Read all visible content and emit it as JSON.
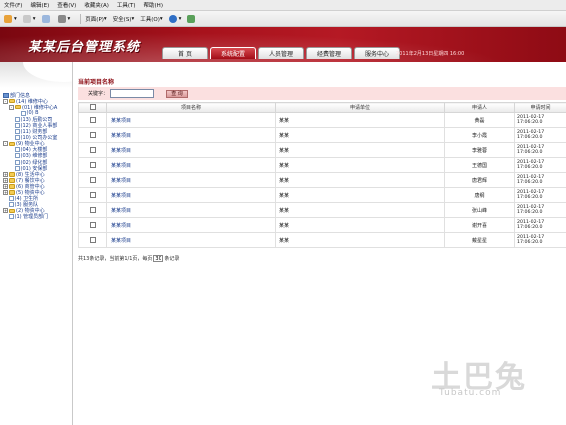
{
  "browser": {
    "menus": [
      "文件(F)",
      "编辑(E)",
      "查看(V)",
      "收藏夹(A)",
      "工具(T)",
      "帮助(H)"
    ],
    "toolbar": {
      "page": "页面(P)",
      "safety": "安全(S)",
      "tools": "工具(O)"
    }
  },
  "header": {
    "app_title": "某某后台管理系统",
    "tabs": [
      "首 页",
      "系统配置",
      "人员管理",
      "经费管理",
      "服务中心"
    ],
    "active_tab": 1,
    "date_text": "2011年2月13日星期四 16:00"
  },
  "tree": {
    "root": "部门信息",
    "nodes": [
      {
        "label": "(14) 维修中心",
        "level": 0,
        "expander": "-",
        "icon": "folder-icon"
      },
      {
        "label": "(01) 维修中心A",
        "level": 1,
        "expander": "-",
        "icon": "folder-icon"
      },
      {
        "label": "(0) B",
        "level": 2,
        "expander": "",
        "icon": "doc-icon"
      },
      {
        "label": "(13) 后勤公司",
        "level": 1,
        "expander": "",
        "icon": "doc-icon"
      },
      {
        "label": "(12) 商业人事部",
        "level": 1,
        "expander": "",
        "icon": "doc-icon"
      },
      {
        "label": "(11) 财务部",
        "level": 1,
        "expander": "",
        "icon": "doc-icon"
      },
      {
        "label": "(10) 公司办公室",
        "level": 1,
        "expander": "",
        "icon": "doc-icon"
      },
      {
        "label": "(9) 物业中心",
        "level": 0,
        "expander": "-",
        "icon": "folder-icon"
      },
      {
        "label": "(04) 大楼部",
        "level": 1,
        "expander": "",
        "icon": "doc-icon"
      },
      {
        "label": "(03) 维修部",
        "level": 1,
        "expander": "",
        "icon": "doc-icon"
      },
      {
        "label": "(02) 绿化部",
        "level": 1,
        "expander": "",
        "icon": "doc-icon"
      },
      {
        "label": "(01) 安保部",
        "level": 1,
        "expander": "",
        "icon": "doc-icon"
      },
      {
        "label": "(8) 生活中心",
        "level": 0,
        "expander": "+",
        "icon": "folder-icon"
      },
      {
        "label": "(7) 餐饮中心",
        "level": 0,
        "expander": "+",
        "icon": "folder-icon"
      },
      {
        "label": "(6) 商管中心",
        "level": 0,
        "expander": "+",
        "icon": "folder-icon"
      },
      {
        "label": "(5) 物资中心",
        "level": 0,
        "expander": "+",
        "icon": "folder-icon"
      },
      {
        "label": "(4) 卫生所",
        "level": 0,
        "expander": "",
        "icon": "doc-icon"
      },
      {
        "label": "(3) 服务队",
        "level": 0,
        "expander": "",
        "icon": "doc-icon"
      },
      {
        "label": "(2) 物资中心",
        "level": 0,
        "expander": "+",
        "icon": "folder-icon"
      },
      {
        "label": "(1) 管理员部门",
        "level": 0,
        "expander": "",
        "icon": "doc-icon"
      }
    ]
  },
  "main": {
    "section_title": "当前项目名称",
    "search": {
      "label": "关键字：",
      "value": "",
      "button": "查 询"
    },
    "columns": [
      "",
      "项目名称",
      "申请单位",
      "申请人",
      "申请时间"
    ],
    "rows": [
      {
        "name": "某某项目",
        "unit": "某某",
        "applicant": "黄磊",
        "date1": "2011-02-17",
        "date2": "17:06:20.0"
      },
      {
        "name": "某某项目",
        "unit": "某某",
        "applicant": "李小霞",
        "date1": "2011-02-17",
        "date2": "17:06:20.0"
      },
      {
        "name": "某某项目",
        "unit": "某某",
        "applicant": "李雅蓉",
        "date1": "2011-02-17",
        "date2": "17:06:20.0"
      },
      {
        "name": "某某项目",
        "unit": "某某",
        "applicant": "王德国",
        "date1": "2011-02-17",
        "date2": "17:06:20.0"
      },
      {
        "name": "某某项目",
        "unit": "某某",
        "applicant": "唐君辉",
        "date1": "2011-02-17",
        "date2": "17:06:20.0"
      },
      {
        "name": "某某项目",
        "unit": "某某",
        "applicant": "唐纲",
        "date1": "2011-02-17",
        "date2": "17:06:20.0"
      },
      {
        "name": "某某项目",
        "unit": "某某",
        "applicant": "张山峰",
        "date1": "2011-02-17",
        "date2": "17:06:20.0"
      },
      {
        "name": "某某项目",
        "unit": "某某",
        "applicant": "谢开喜",
        "date1": "2011-02-17",
        "date2": "17:06:20.0"
      },
      {
        "name": "某某项目",
        "unit": "某某",
        "applicant": "戴星星",
        "date1": "2011-02-17",
        "date2": "17:06:20.0"
      }
    ],
    "pager": {
      "prefix": "共13条记录，当前第1/1页，每页",
      "page_size": "30",
      "suffix": "条记录"
    }
  },
  "watermark": {
    "big": "土巴兔",
    "small": "Tubatu.com"
  },
  "colors": {
    "header_red": "#a7121c",
    "title_red": "#8b0a12",
    "link_blue": "#1a3c8c",
    "search_bg": "#fbe0e0"
  }
}
